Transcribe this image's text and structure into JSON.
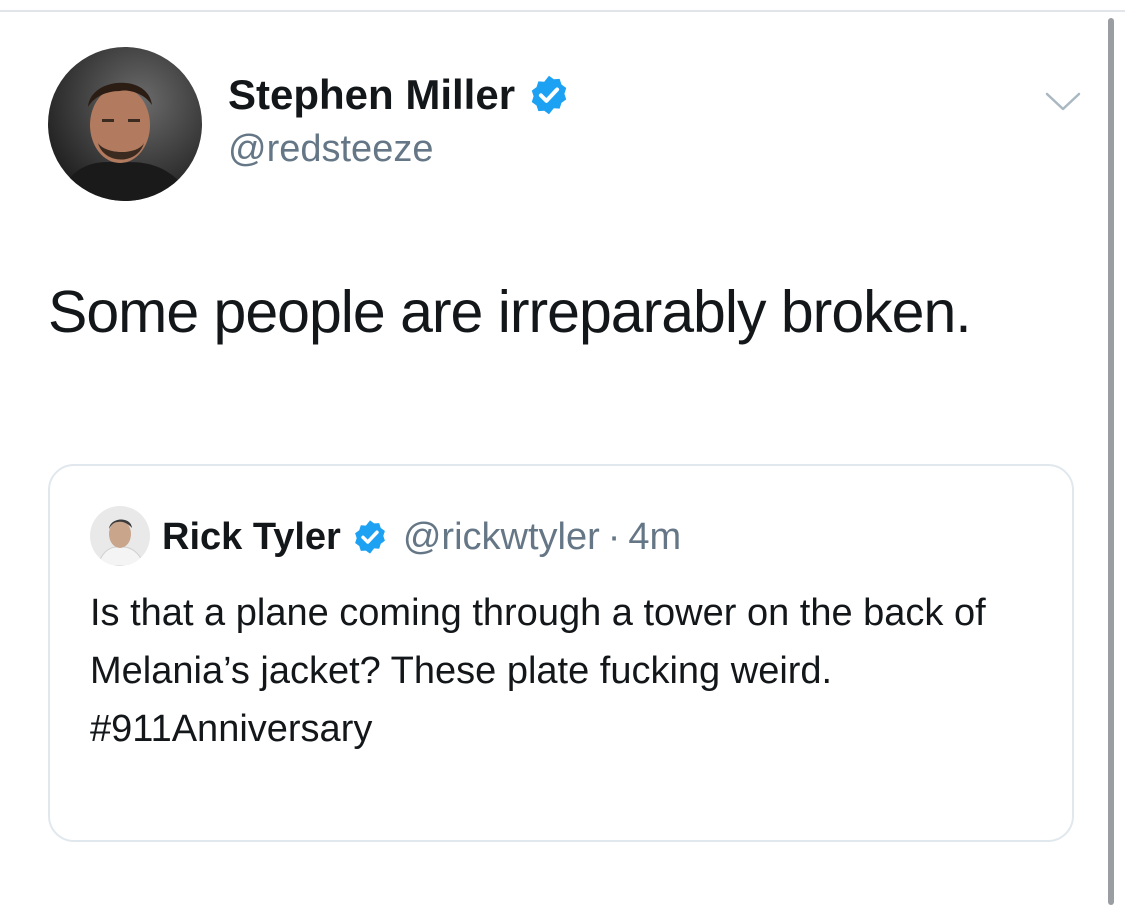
{
  "tweet": {
    "author": {
      "name": "Stephen Miller",
      "handle": "@redsteeze",
      "verified": true
    },
    "text": "Some people are irreparably broken.",
    "menu_icon": "chevron-down-icon"
  },
  "quoted_tweet": {
    "author": {
      "name": "Rick Tyler",
      "handle": "@rickwtyler",
      "verified": true
    },
    "separator": "·",
    "time": "4m",
    "text": "Is that a plane coming through a tower on the back of Melania’s jacket? These plate fucking weird.",
    "hashtag": "#911Anniversary"
  },
  "colors": {
    "verified_blue": "#1da1f2",
    "secondary_text": "#657786",
    "border": "#e1e8ed"
  }
}
